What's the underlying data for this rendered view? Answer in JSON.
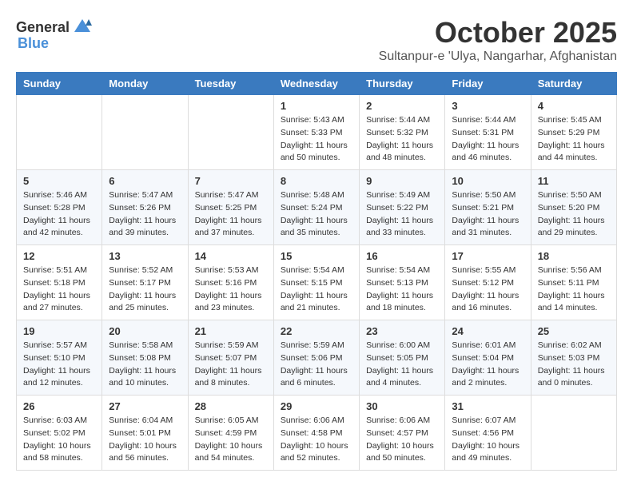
{
  "header": {
    "logo_general": "General",
    "logo_blue": "Blue",
    "month": "October 2025",
    "location": "Sultanpur-e 'Ulya, Nangarhar, Afghanistan"
  },
  "weekdays": [
    "Sunday",
    "Monday",
    "Tuesday",
    "Wednesday",
    "Thursday",
    "Friday",
    "Saturday"
  ],
  "weeks": [
    [
      {
        "day": "",
        "info": ""
      },
      {
        "day": "",
        "info": ""
      },
      {
        "day": "",
        "info": ""
      },
      {
        "day": "1",
        "info": "Sunrise: 5:43 AM\nSunset: 5:33 PM\nDaylight: 11 hours\nand 50 minutes."
      },
      {
        "day": "2",
        "info": "Sunrise: 5:44 AM\nSunset: 5:32 PM\nDaylight: 11 hours\nand 48 minutes."
      },
      {
        "day": "3",
        "info": "Sunrise: 5:44 AM\nSunset: 5:31 PM\nDaylight: 11 hours\nand 46 minutes."
      },
      {
        "day": "4",
        "info": "Sunrise: 5:45 AM\nSunset: 5:29 PM\nDaylight: 11 hours\nand 44 minutes."
      }
    ],
    [
      {
        "day": "5",
        "info": "Sunrise: 5:46 AM\nSunset: 5:28 PM\nDaylight: 11 hours\nand 42 minutes."
      },
      {
        "day": "6",
        "info": "Sunrise: 5:47 AM\nSunset: 5:26 PM\nDaylight: 11 hours\nand 39 minutes."
      },
      {
        "day": "7",
        "info": "Sunrise: 5:47 AM\nSunset: 5:25 PM\nDaylight: 11 hours\nand 37 minutes."
      },
      {
        "day": "8",
        "info": "Sunrise: 5:48 AM\nSunset: 5:24 PM\nDaylight: 11 hours\nand 35 minutes."
      },
      {
        "day": "9",
        "info": "Sunrise: 5:49 AM\nSunset: 5:22 PM\nDaylight: 11 hours\nand 33 minutes."
      },
      {
        "day": "10",
        "info": "Sunrise: 5:50 AM\nSunset: 5:21 PM\nDaylight: 11 hours\nand 31 minutes."
      },
      {
        "day": "11",
        "info": "Sunrise: 5:50 AM\nSunset: 5:20 PM\nDaylight: 11 hours\nand 29 minutes."
      }
    ],
    [
      {
        "day": "12",
        "info": "Sunrise: 5:51 AM\nSunset: 5:18 PM\nDaylight: 11 hours\nand 27 minutes."
      },
      {
        "day": "13",
        "info": "Sunrise: 5:52 AM\nSunset: 5:17 PM\nDaylight: 11 hours\nand 25 minutes."
      },
      {
        "day": "14",
        "info": "Sunrise: 5:53 AM\nSunset: 5:16 PM\nDaylight: 11 hours\nand 23 minutes."
      },
      {
        "day": "15",
        "info": "Sunrise: 5:54 AM\nSunset: 5:15 PM\nDaylight: 11 hours\nand 21 minutes."
      },
      {
        "day": "16",
        "info": "Sunrise: 5:54 AM\nSunset: 5:13 PM\nDaylight: 11 hours\nand 18 minutes."
      },
      {
        "day": "17",
        "info": "Sunrise: 5:55 AM\nSunset: 5:12 PM\nDaylight: 11 hours\nand 16 minutes."
      },
      {
        "day": "18",
        "info": "Sunrise: 5:56 AM\nSunset: 5:11 PM\nDaylight: 11 hours\nand 14 minutes."
      }
    ],
    [
      {
        "day": "19",
        "info": "Sunrise: 5:57 AM\nSunset: 5:10 PM\nDaylight: 11 hours\nand 12 minutes."
      },
      {
        "day": "20",
        "info": "Sunrise: 5:58 AM\nSunset: 5:08 PM\nDaylight: 11 hours\nand 10 minutes."
      },
      {
        "day": "21",
        "info": "Sunrise: 5:59 AM\nSunset: 5:07 PM\nDaylight: 11 hours\nand 8 minutes."
      },
      {
        "day": "22",
        "info": "Sunrise: 5:59 AM\nSunset: 5:06 PM\nDaylight: 11 hours\nand 6 minutes."
      },
      {
        "day": "23",
        "info": "Sunrise: 6:00 AM\nSunset: 5:05 PM\nDaylight: 11 hours\nand 4 minutes."
      },
      {
        "day": "24",
        "info": "Sunrise: 6:01 AM\nSunset: 5:04 PM\nDaylight: 11 hours\nand 2 minutes."
      },
      {
        "day": "25",
        "info": "Sunrise: 6:02 AM\nSunset: 5:03 PM\nDaylight: 11 hours\nand 0 minutes."
      }
    ],
    [
      {
        "day": "26",
        "info": "Sunrise: 6:03 AM\nSunset: 5:02 PM\nDaylight: 10 hours\nand 58 minutes."
      },
      {
        "day": "27",
        "info": "Sunrise: 6:04 AM\nSunset: 5:01 PM\nDaylight: 10 hours\nand 56 minutes."
      },
      {
        "day": "28",
        "info": "Sunrise: 6:05 AM\nSunset: 4:59 PM\nDaylight: 10 hours\nand 54 minutes."
      },
      {
        "day": "29",
        "info": "Sunrise: 6:06 AM\nSunset: 4:58 PM\nDaylight: 10 hours\nand 52 minutes."
      },
      {
        "day": "30",
        "info": "Sunrise: 6:06 AM\nSunset: 4:57 PM\nDaylight: 10 hours\nand 50 minutes."
      },
      {
        "day": "31",
        "info": "Sunrise: 6:07 AM\nSunset: 4:56 PM\nDaylight: 10 hours\nand 49 minutes."
      },
      {
        "day": "",
        "info": ""
      }
    ]
  ]
}
